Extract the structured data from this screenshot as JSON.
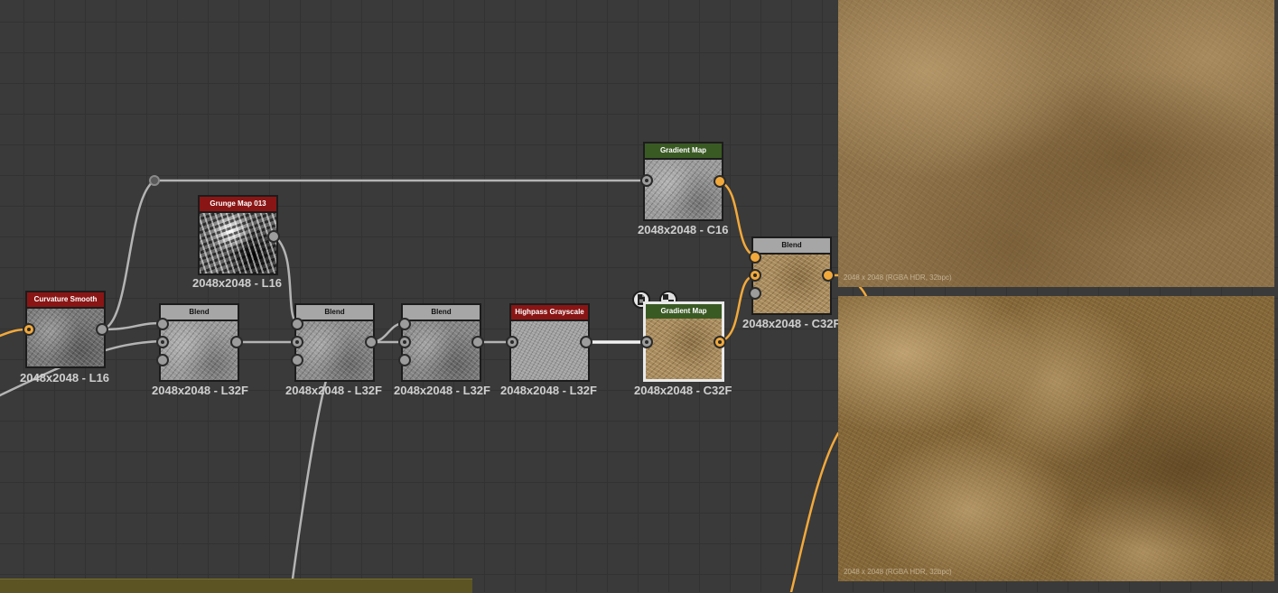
{
  "nodes": {
    "curvature_smooth": {
      "title": "Curvature Smooth",
      "size": "2048x2048 - L16"
    },
    "grunge_map": {
      "title": "Grunge Map 013",
      "size": "2048x2048 - L16"
    },
    "blend_1": {
      "title": "Blend",
      "size": "2048x2048 - L32F"
    },
    "blend_2": {
      "title": "Blend",
      "size": "2048x2048 - L32F"
    },
    "blend_3": {
      "title": "Blend",
      "size": "2048x2048 - L32F"
    },
    "highpass": {
      "title": "Highpass Grayscale",
      "size": "2048x2048 - L32F"
    },
    "gradient_map_top": {
      "title": "Gradient Map",
      "size": "2048x2048 - C16"
    },
    "gradient_map_sel": {
      "title": "Gradient Map",
      "size": "2048x2048 - C32F"
    },
    "blend_final": {
      "title": "Blend",
      "size": "2048x2048 - C32F"
    }
  },
  "previews": {
    "top_info": "2048 x 2048 (RGBA HDR, 32bpc)",
    "bottom_info": "2048 x 2048 (RGBA HDR, 32bpc)"
  },
  "colors": {
    "canvas": "#3a3a3a",
    "link_gray": "#b4b4b4",
    "link_orange": "#f2a93b",
    "header_red": "#8a1515",
    "header_green": "#3a5a24",
    "header_gray": "#a6a6a6"
  },
  "icons": {
    "node_toolbar": [
      "document-icon",
      "checker-icon"
    ]
  }
}
